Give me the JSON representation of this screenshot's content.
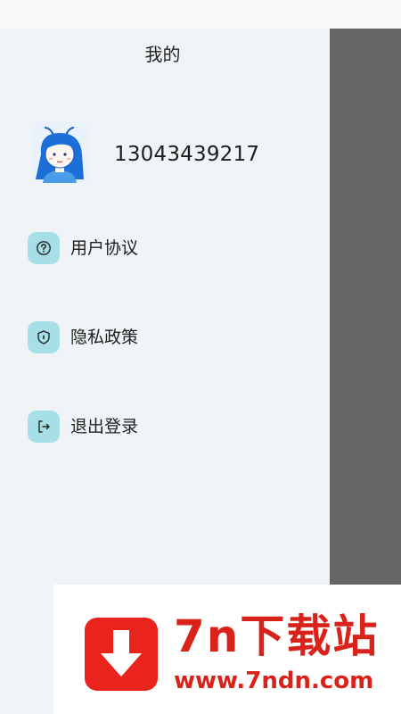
{
  "header": {
    "title": "我的"
  },
  "profile": {
    "phone": "13043439217"
  },
  "menu": [
    {
      "label": "用户协议",
      "icon": "question-circle-icon"
    },
    {
      "label": "隐私政策",
      "icon": "shield-icon"
    },
    {
      "label": "退出登录",
      "icon": "logout-icon"
    }
  ],
  "watermark": {
    "title": "7n下载站",
    "url": "www.7ndn.com"
  },
  "colors": {
    "icon_bg": "#a6dfe6",
    "drawer_bg": "#f0f4f6",
    "scrim": "#666767",
    "brand_red": "#e8241c"
  }
}
